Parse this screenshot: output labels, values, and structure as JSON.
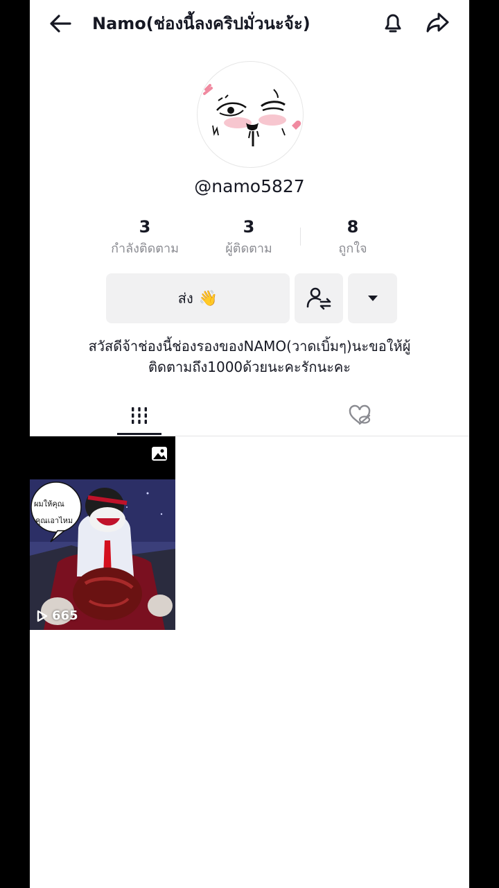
{
  "header": {
    "title": "Namo(ช่องนี้ลงคริปมั่วนะจ้ะ)",
    "back_icon": "arrow-left-icon",
    "bell_icon": "bell-icon",
    "share_icon": "share-arrow-icon"
  },
  "profile": {
    "username": "@namo5827"
  },
  "stats": [
    {
      "value": "3",
      "label": "กำลังติดตาม"
    },
    {
      "value": "3",
      "label": "ผู้ติดตาม"
    },
    {
      "value": "8",
      "label": "ถูกใจ"
    }
  ],
  "actions": {
    "message_label": "ส่ง",
    "message_emoji": "👋",
    "friend_icon": "user-swap-icon",
    "more_icon": "caret-down-icon"
  },
  "bio": {
    "line1": "สวัสดีจ้าช่องนี้ช่องรองของNAMO(วาดเบิ้มๆ)นะขอให้ผู้",
    "line2": "ติดตามถึง1000ด้วยนะคะรักนะคะ"
  },
  "tabs": {
    "videos_icon": "grid-icon",
    "liked_icon": "heart-hidden-icon"
  },
  "posts": [
    {
      "views": "665",
      "bubble_line1": "ผมให้คุณ",
      "bubble_line2": "คุณเอาไหม",
      "type_icon": "photo-icon"
    }
  ],
  "colors": {
    "text": "#161823",
    "secondary": "#8a8b91",
    "button_bg": "#f1f1f2"
  }
}
